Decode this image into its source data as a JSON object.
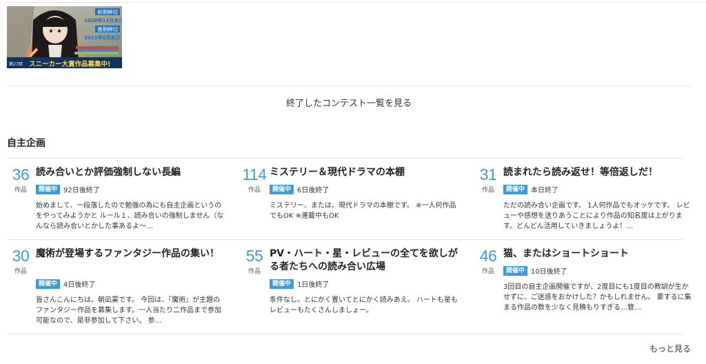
{
  "banner": {
    "deadline1_label": "前期締切",
    "deadline1_date": "2020年12月末日",
    "deadline2_label": "後期締切",
    "deadline2_date": "2021年6月末日",
    "caption_small": "第27回",
    "caption": "スニーカー大賞作品募集中!"
  },
  "ended_contests_link": "終了したコンテスト一覧を見る",
  "section_title": "自主企画",
  "cards": [
    {
      "count": "36",
      "unit": "作品",
      "title": "読み合いとか評価強制しない長編",
      "badge": "開催中",
      "ends": "92日後終了",
      "desc": "始めまして、一段落したので勉強の為にも自主企画というのをやってみようかと ルール１、読み合いの強制しません（なんなら読み合いとかした事あるよ～…"
    },
    {
      "count": "114",
      "unit": "作品",
      "title": "ミステリー＆現代ドラマの本棚",
      "badge": "開催中",
      "ends": "6日後終了",
      "desc": "ミステリー、または、現代ドラマの本棚です。 ※一人何作品でもOK ※連載中もOK"
    },
    {
      "count": "31",
      "unit": "作品",
      "title": "読まれたら読み返せ！等倍返しだ！",
      "badge": "開催中",
      "ends": "本日終了",
      "desc": "ただの読み合い企画です。 1人何作品でもオッケです。 レビューや感想を送りあうことにより作品の知名度は上がります。どんどん活用していきましょうよ！…"
    },
    {
      "count": "30",
      "unit": "作品",
      "title": "魔術が登場するファンタジー作品の集い！",
      "badge": "開催中",
      "ends": "4日後終了",
      "desc": "皆さんこんにちは、朝凪霙です。 今回は、『魔術』が主題のファンタジー作品を募集します。一人当たり二作品まで参加可能なので、是非参加して下さい。 参…"
    },
    {
      "count": "55",
      "unit": "作品",
      "title": "PV・ハート・星・レビューの全てを欲しがる者たちへの読み合い広場",
      "badge": "開催中",
      "ends": "1日後終了",
      "desc": "条件なし。とにかく置いてとにかく読みあえ。 ハートも星もレビューもたくさんしましょー。"
    },
    {
      "count": "46",
      "unit": "作品",
      "title": "猫、またはショートショート",
      "badge": "開催中",
      "ends": "10日後終了",
      "desc": "3回目の自主企画開催ですが、2度目にも1度目の教訓が生かせずに、ご迷惑をおかけした？かもしれません。 要するに集まる作品の数を少なく見積もりすぎる…管…"
    }
  ],
  "more_link": "もっと見る",
  "colors": {
    "accent": "#3d9bd6",
    "divider": "#e2e2e2"
  }
}
